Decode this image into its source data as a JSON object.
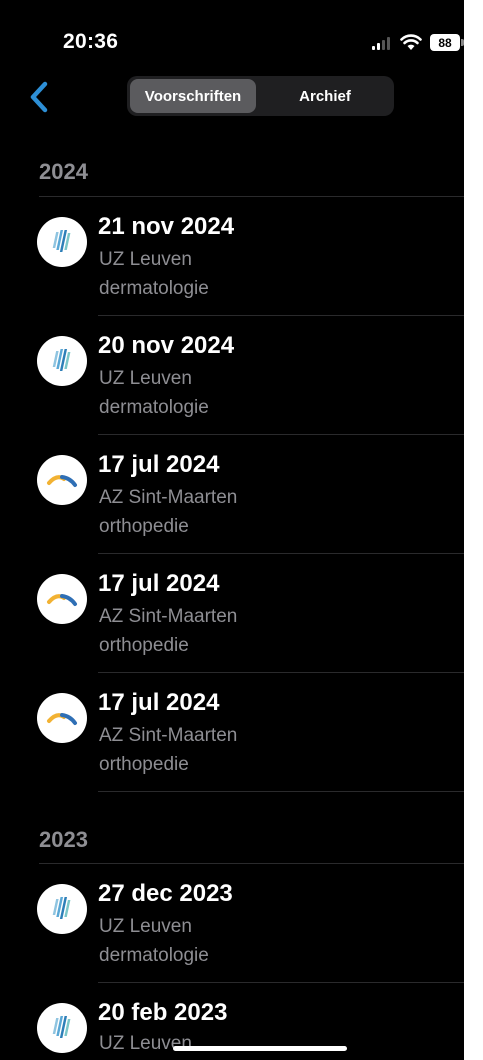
{
  "status_bar": {
    "time": "20:36",
    "battery": "88",
    "signal_icon": "cellular-signal-icon",
    "wifi_icon": "wifi-icon"
  },
  "nav": {
    "back_icon": "chevron-left-icon",
    "back_color": "#2d8fd6",
    "tabs": [
      {
        "label": "Voorschriften",
        "selected": true
      },
      {
        "label": "Archief",
        "selected": false
      }
    ]
  },
  "sections": [
    {
      "year": "2024",
      "items": [
        {
          "date": "21 nov 2024",
          "hospital": "UZ Leuven",
          "department": "dermatologie",
          "logo": "uz-leuven-logo"
        },
        {
          "date": "20 nov 2024",
          "hospital": "UZ Leuven",
          "department": "dermatologie",
          "logo": "uz-leuven-logo"
        },
        {
          "date": "17 jul 2024",
          "hospital": "AZ Sint-Maarten",
          "department": "orthopedie",
          "logo": "az-sint-maarten-logo"
        },
        {
          "date": "17 jul 2024",
          "hospital": "AZ Sint-Maarten",
          "department": "orthopedie",
          "logo": "az-sint-maarten-logo"
        },
        {
          "date": "17 jul 2024",
          "hospital": "AZ Sint-Maarten",
          "department": "orthopedie",
          "logo": "az-sint-maarten-logo"
        }
      ]
    },
    {
      "year": "2023",
      "items": [
        {
          "date": "27 dec 2023",
          "hospital": "UZ Leuven",
          "department": "dermatologie",
          "logo": "uz-leuven-logo"
        },
        {
          "date": "20 feb 2023",
          "hospital": "UZ Leuven",
          "department": "",
          "logo": "uz-leuven-logo"
        }
      ]
    }
  ]
}
